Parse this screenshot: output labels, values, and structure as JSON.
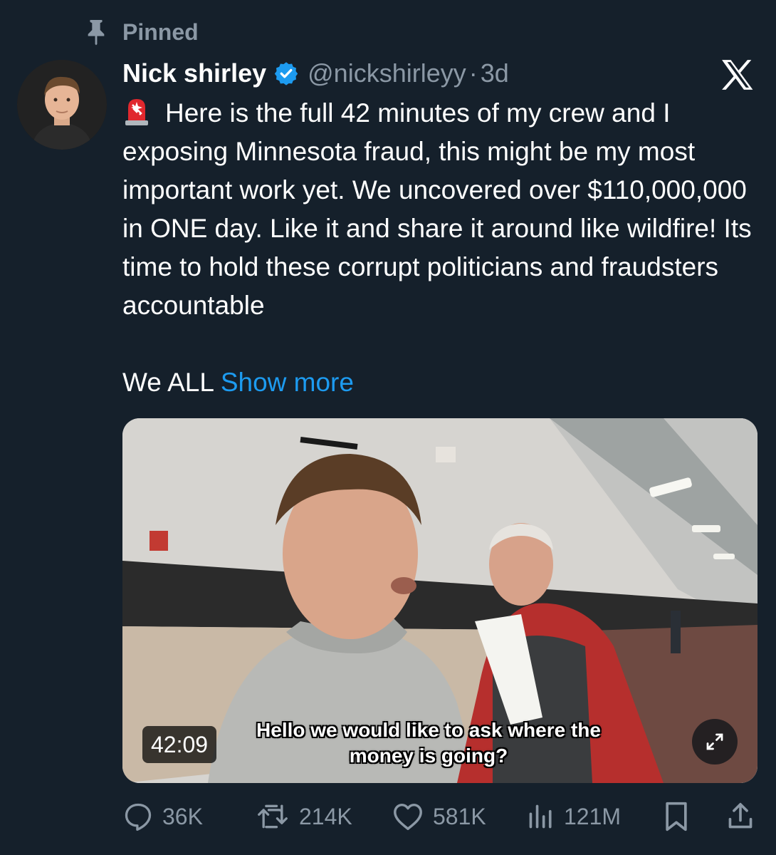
{
  "pinned": {
    "label": "Pinned",
    "icon": "pin-icon"
  },
  "author": {
    "name": "Nick shirley",
    "handle": "@nickshirleyy",
    "separator": "·",
    "time": "3d",
    "verified_icon": "verified-badge-icon"
  },
  "platform_icon": "x-logo-icon",
  "tweet": {
    "emoji": "rotating-light-icon",
    "text": "Here is the full 42 minutes of my crew and I exposing Minnesota fraud, this might be my most important work yet. We uncovered over $110,000,000 in ONE day. Like it and share it around like wildfire! Its time to hold these corrupt politicians and fraudsters accountable",
    "continuation": "We ALL",
    "show_more": "Show more"
  },
  "media": {
    "caption_line1": "Hello we would like to ask where the",
    "caption_line2": "money is going?",
    "duration": "42:09",
    "expand_icon": "expand-icon"
  },
  "actions": {
    "replies": "36K",
    "retweets": "214K",
    "likes": "581K",
    "views": "121M"
  },
  "colors": {
    "background": "#15202b",
    "text": "#ffffff",
    "secondary": "#8b98a5",
    "accent": "#1d9bf0"
  }
}
